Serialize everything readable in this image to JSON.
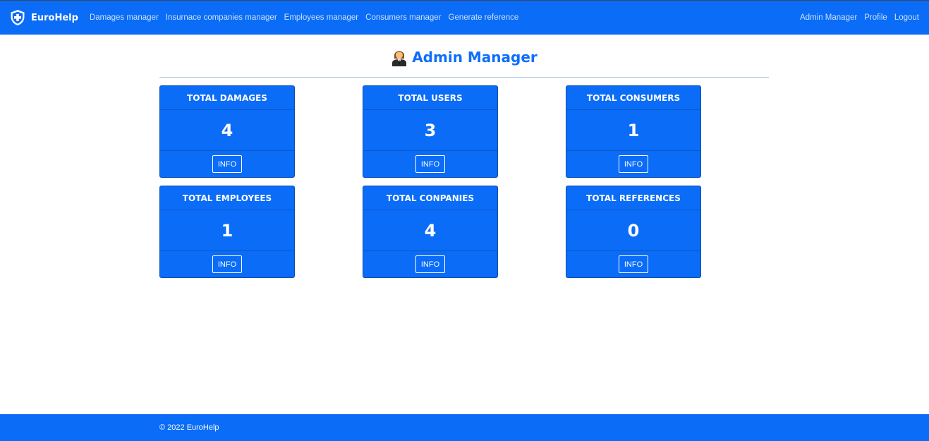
{
  "navbar": {
    "brand": "EuroHelp",
    "brand_icon": "shield-plus-icon",
    "links": [
      {
        "label": "Damages manager"
      },
      {
        "label": "Insurnace companies manager"
      },
      {
        "label": "Employees manager"
      },
      {
        "label": "Consumers manager"
      },
      {
        "label": "Generate reference"
      }
    ],
    "right_links": [
      {
        "label": "Admin Manager"
      },
      {
        "label": "Profile"
      },
      {
        "label": "Logout"
      }
    ]
  },
  "page": {
    "title": "Admin Manager",
    "title_icon": "admin-person-icon",
    "title_color": "#0d6efd"
  },
  "cards": [
    {
      "title": "TOTAL DAMAGES",
      "value": "4",
      "button": "INFO"
    },
    {
      "title": "TOTAL USERS",
      "value": "3",
      "button": "INFO"
    },
    {
      "title": "TOTAL CONSUMERS",
      "value": "1",
      "button": "INFO"
    },
    {
      "title": "TOTAL EMPLOYEES",
      "value": "1",
      "button": "INFO"
    },
    {
      "title": "TOTAL CONPANIES",
      "value": "4",
      "button": "INFO"
    },
    {
      "title": "TOTAL REFERENCES",
      "value": "0",
      "button": "INFO"
    }
  ],
  "footer": {
    "text": "© 2022 EuroHelp"
  },
  "colors": {
    "primary": "#0a6cf7",
    "nav_link": "#c9e0ff",
    "white": "#ffffff"
  }
}
